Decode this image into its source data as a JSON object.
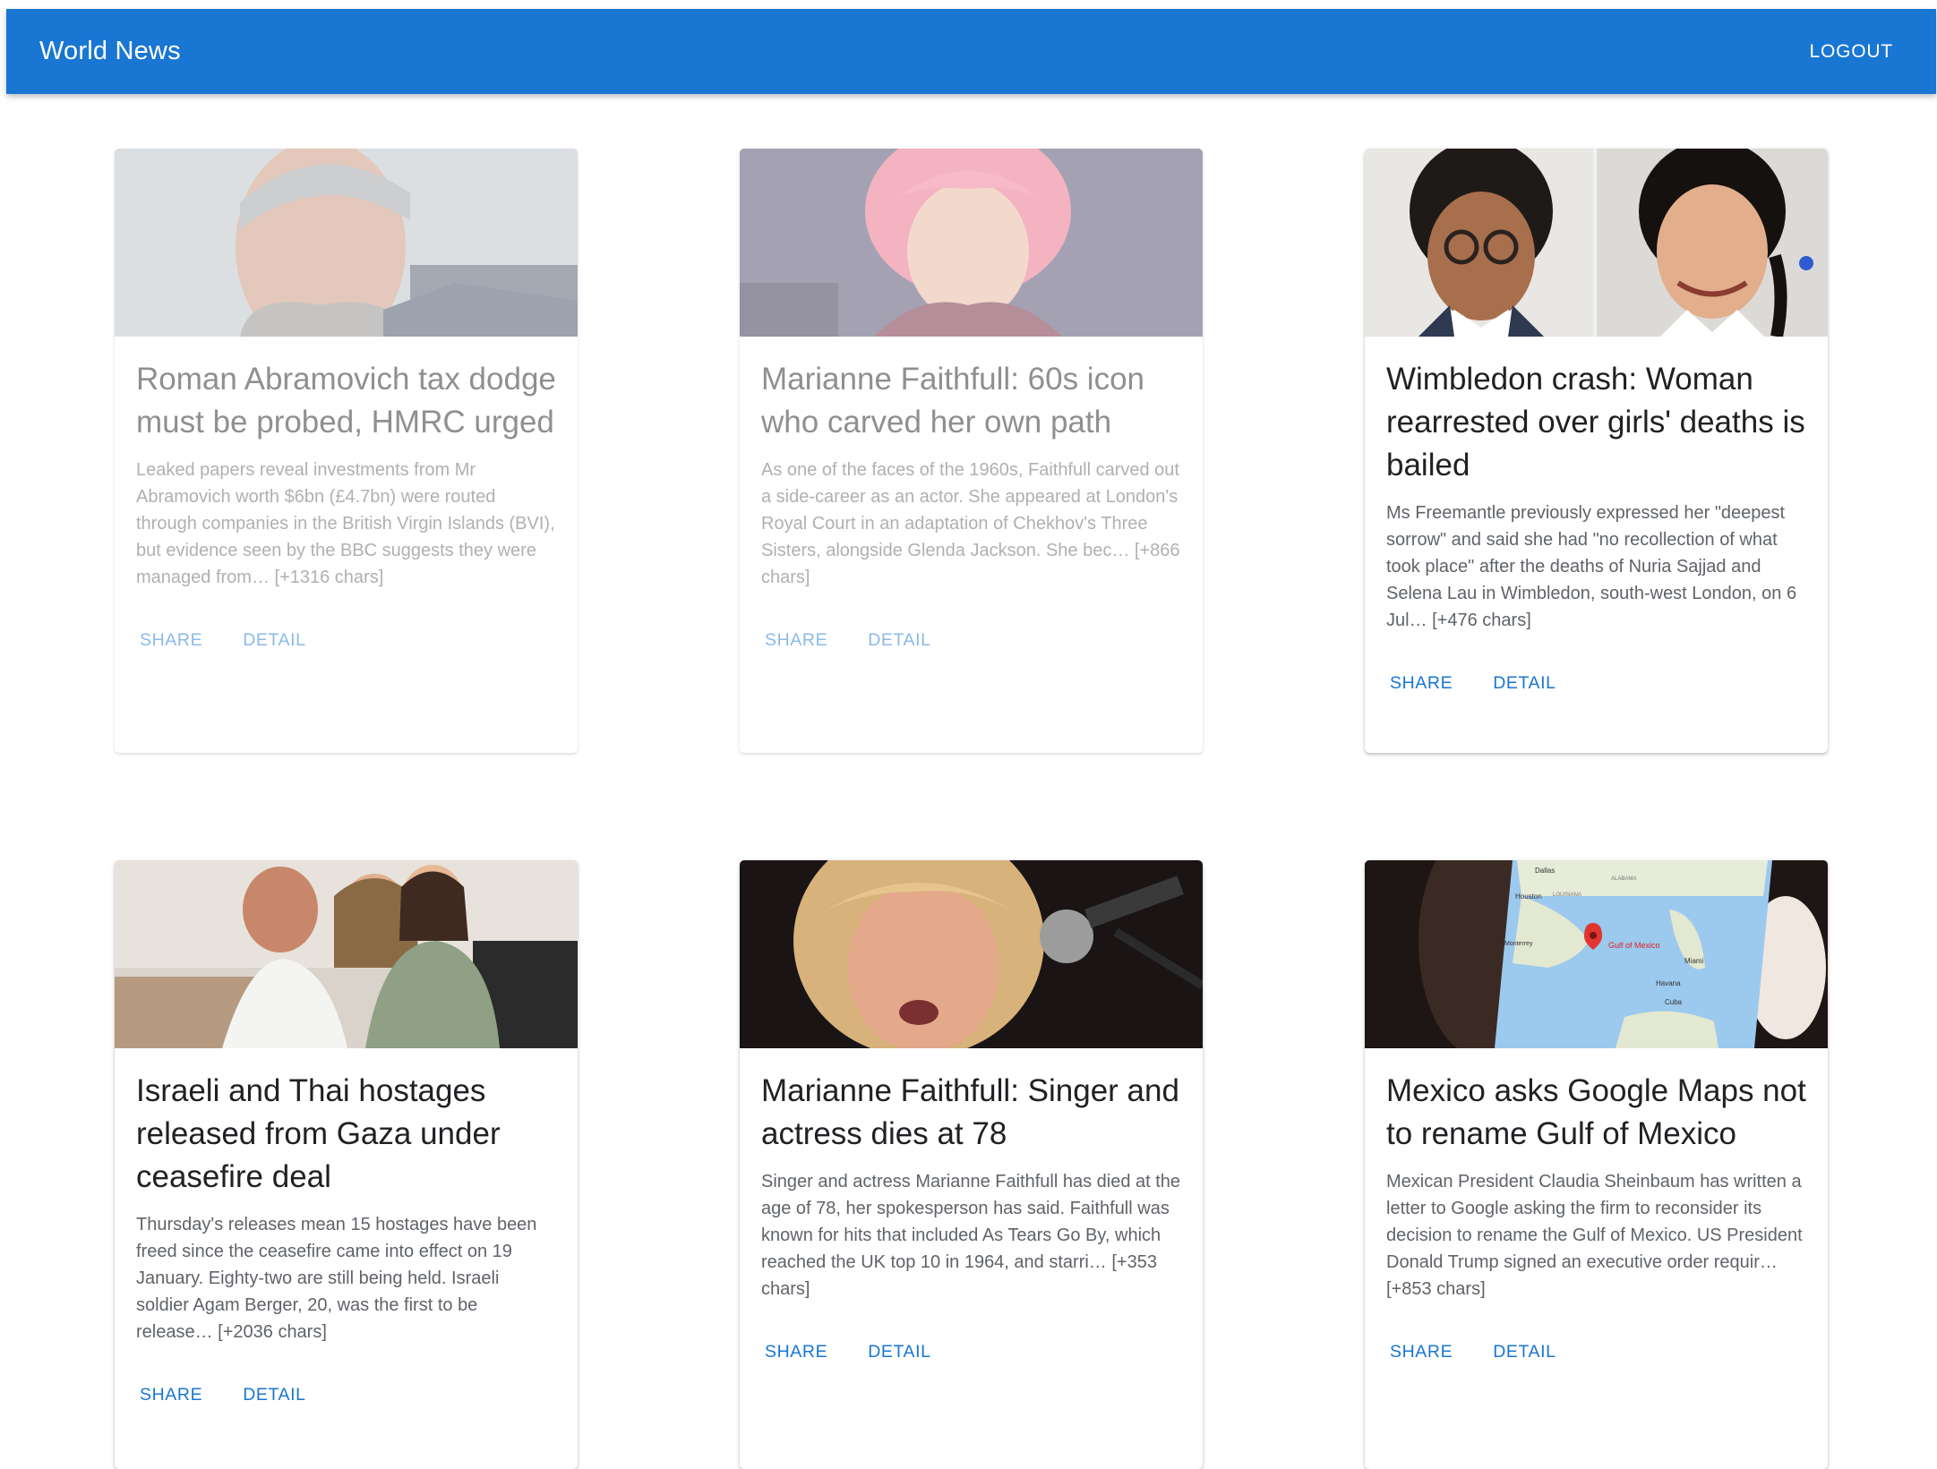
{
  "appbar": {
    "title": "World News",
    "logout_label": "LOGOUT"
  },
  "cards": [
    {
      "title": "Roman Abramovich tax dodge must be probed, HMRC urged",
      "description": "Leaked papers reveal investments from Mr Abramovich worth $6bn (£4.7bn) were routed through companies in the British Virgin Islands (BVI), but evidence seen by the BBC suggests they were managed from… [+1316 chars]",
      "share_label": "SHARE",
      "detail_label": "DETAIL",
      "image_subject": "portrait-man-grey-hair"
    },
    {
      "title": "Marianne Faithfull: 60s icon who carved her own path",
      "description": "As one of the faces of the 1960s, Faithfull carved out a side-career as an actor. She appeared at London's Royal Court in an adaptation of Chekhov's Three Sisters, alongside Glenda Jackson. She bec… [+866 chars]",
      "share_label": "SHARE",
      "detail_label": "DETAIL",
      "image_subject": "woman-pink-hair-smiling"
    },
    {
      "title": "Wimbledon crash: Woman rearrested over girls' deaths is bailed",
      "description": "Ms Freemantle previously expressed her \"deepest sorrow\" and said she had \"no recollection of what took place\" after the deaths of Nuria Sajjad and Selena Lau in Wimbledon, south-west London, on 6 Jul… [+476 chars]",
      "share_label": "SHARE",
      "detail_label": "DETAIL",
      "image_subject": "two-girls-school-portraits"
    },
    {
      "title": "Israeli and Thai hostages released from Gaza under ceasefire deal",
      "description": "Thursday's releases mean 15 hostages have been freed since the ceasefire came into effect on 19 January. Eighty-two are still being held. Israeli soldier Agam Berger, 20, was the first to be release… [+2036 chars]",
      "share_label": "SHARE",
      "detail_label": "DETAIL",
      "image_subject": "family-embrace-on-sofa"
    },
    {
      "title": "Marianne Faithfull: Singer and actress dies at 78",
      "description": "Singer and actress Marianne Faithfull has died at the age of 78, her spokesperson has said. Faithfull was known for hits that included As Tears Go By, which reached the UK top 10 in 1964, and starri… [+353 chars]",
      "share_label": "SHARE",
      "detail_label": "DETAIL",
      "image_subject": "singer-with-microphone"
    },
    {
      "title": "Mexico asks Google Maps not to rename Gulf of Mexico",
      "description": "Mexican President Claudia Sheinbaum has written a letter to Google asking the firm to reconsider its decision to rename the Gulf of Mexico. US President Donald Trump signed an executive order requir… [+853 chars]",
      "share_label": "SHARE",
      "detail_label": "DETAIL",
      "image_subject": "phone-showing-map",
      "map_labels": [
        "Dallas",
        "Houston",
        "Gulf of Mexico",
        "Miami",
        "Havana",
        "Cuba",
        "ALABAMA",
        "LOUISIANA",
        "Monterrey"
      ]
    }
  ]
}
